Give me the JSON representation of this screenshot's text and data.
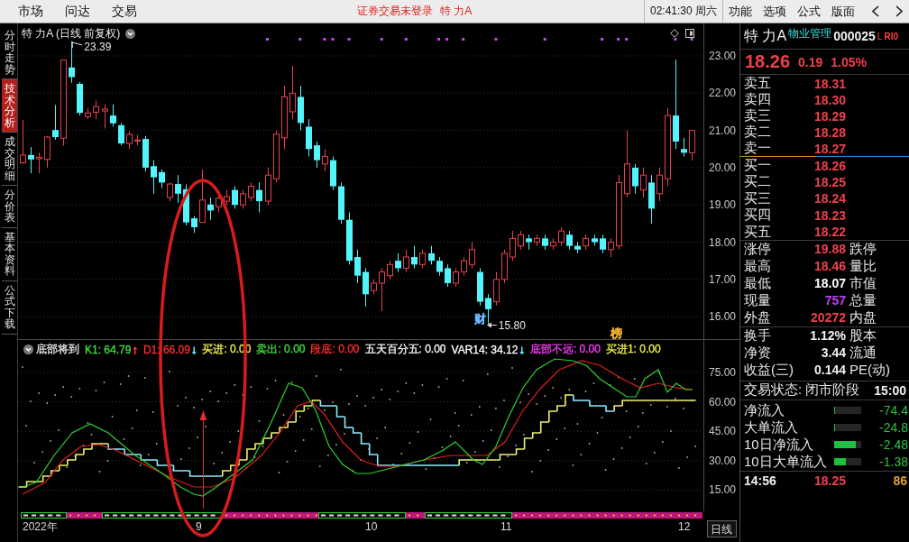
{
  "top_bar": {
    "menu": [
      {
        "label": "市场"
      },
      {
        "label": "问达"
      },
      {
        "label": "交易"
      }
    ],
    "login_status": "证券交易未登录",
    "stock": "特 力A",
    "clock": "02:41:30 周六",
    "tools": [
      {
        "label": "功能"
      },
      {
        "label": "选项"
      },
      {
        "label": "公式"
      },
      {
        "label": "版面"
      }
    ]
  },
  "side_tabs": [
    {
      "label": "分时走势",
      "selected": false
    },
    {
      "label": "技术分析",
      "selected": true
    },
    {
      "label": "成交明细",
      "selected": false
    },
    {
      "label": "分价表",
      "selected": false
    },
    {
      "label": "基本资料",
      "selected": false
    },
    {
      "label": "公式下载",
      "selected": false
    }
  ],
  "price_chart": {
    "title": "特 力A (日线 前复权)",
    "high_label": "23.39",
    "low_label": "15.80",
    "events": [
      {
        "label": "财",
        "color": "#6cb8ff"
      },
      {
        "label": "榜",
        "color": "#e8b030"
      }
    ],
    "y_ticks": [
      "23.00",
      "22.00",
      "21.00",
      "20.00",
      "19.00",
      "18.00",
      "17.00",
      "16.00"
    ]
  },
  "indicator": {
    "name": "底部将到",
    "values": [
      {
        "text": "K1: 64.79",
        "color": "#40e040",
        "arrow": {
          "glyph": "↑",
          "color": "#ff3030"
        }
      },
      {
        "text": "D1: 66.09",
        "color": "#ff3030",
        "arrow": {
          "glyph": "↓",
          "color": "#50e8ff"
        }
      },
      {
        "text": "买进: 0.00",
        "color": "#f0f050"
      },
      {
        "text": "卖出: 0.00",
        "color": "#40e040"
      },
      {
        "text": "段底: 0.00",
        "color": "#ff3030"
      },
      {
        "text": "五天百分五: 0.00",
        "color": "#ffffff"
      },
      {
        "text": "VAR14: 34.12",
        "color": "#ffffff",
        "arrow": {
          "glyph": "↓",
          "color": "#50e8ff"
        }
      },
      {
        "text": "底部不远: 0.00",
        "color": "#ff40ff"
      },
      {
        "text": "买进1: 0.00",
        "color": "#f0f050"
      }
    ],
    "y_ticks": [
      "75.00",
      "60.00",
      "45.00",
      "30.00",
      "15.00"
    ]
  },
  "time_axis": {
    "labels": [
      "2022年",
      "9",
      "10",
      "11",
      "12"
    ],
    "period": "日线"
  },
  "quote": {
    "name": "特 力A",
    "industry": "物业管理",
    "code": "000025",
    "flags": [
      "L",
      "RI0"
    ],
    "price": "18.26",
    "change": "0.19",
    "change_pct": "1.05%",
    "asks": [
      {
        "label": "卖五",
        "price": "18.31"
      },
      {
        "label": "卖四",
        "price": "18.30"
      },
      {
        "label": "卖三",
        "price": "18.29"
      },
      {
        "label": "卖二",
        "price": "18.28"
      },
      {
        "label": "卖一",
        "price": "18.27"
      }
    ],
    "bids": [
      {
        "label": "买一",
        "price": "18.26"
      },
      {
        "label": "买二",
        "price": "18.25"
      },
      {
        "label": "买三",
        "price": "18.24"
      },
      {
        "label": "买四",
        "price": "18.23"
      },
      {
        "label": "买五",
        "price": "18.22"
      }
    ],
    "stats": [
      {
        "label": "涨停",
        "value": "19.88",
        "color": "#f0404c",
        "label_2": "跌停"
      },
      {
        "label": "最高",
        "value": "18.46",
        "color": "#f0404c",
        "label_2": "量比"
      },
      {
        "label": "最低",
        "value": "18.07",
        "color": "#ffffff",
        "label_2": "市值"
      },
      {
        "label": "现量",
        "value": "757",
        "color": "#c040ff",
        "label_2": "总量"
      },
      {
        "label": "外盘",
        "value": "20272",
        "color": "#f0404c",
        "label_2": "内盘"
      }
    ],
    "finance": [
      {
        "label": "换手",
        "value": "1.12%",
        "label_2": "股本"
      },
      {
        "label": "净资",
        "value": "3.44",
        "label_2": "流通"
      },
      {
        "label": "收益(三)",
        "value": "0.144",
        "label_2": "PE(动)"
      }
    ],
    "trade_status": "交易状态: 闭市阶段",
    "status_time": "15:00",
    "flows": [
      {
        "label": "净流入",
        "value": "-74.4",
        "level": 0.03
      },
      {
        "label": "大单流入",
        "value": "-24.8",
        "level": 0.03
      },
      {
        "label": "10日净流入",
        "value": "-2.48",
        "level": 0.8
      },
      {
        "label": "10日大单流入",
        "value": "-1.38",
        "level": 0.43
      }
    ],
    "ticks": [
      {
        "time": "14:56",
        "price": "18.25",
        "volume": "86"
      }
    ]
  }
}
